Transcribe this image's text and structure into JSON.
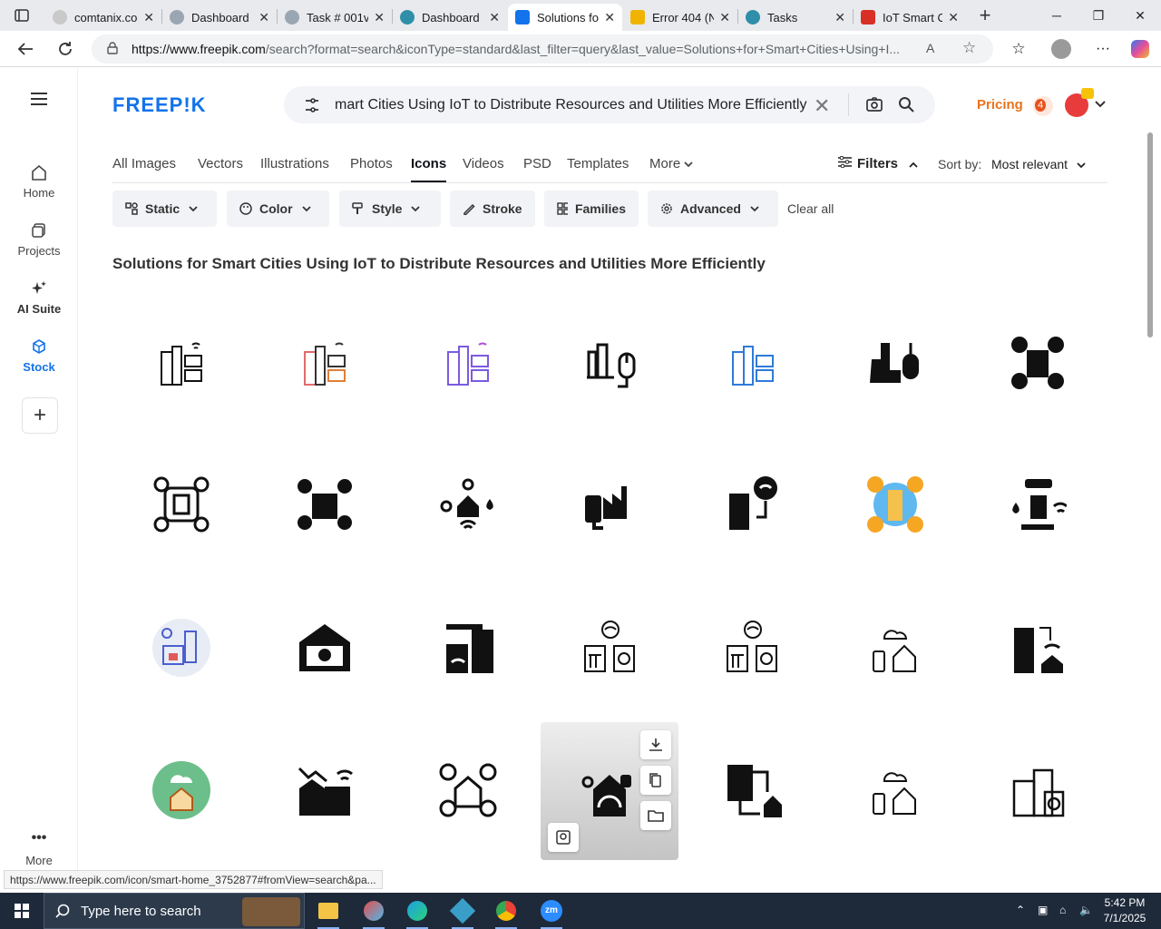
{
  "browser": {
    "tabs": [
      {
        "title": "comtanix.co",
        "favicon_color": "#888888"
      },
      {
        "title": "Dashboard",
        "favicon_color": "#9aa6b2"
      },
      {
        "title": "Task # 001v-",
        "favicon_color": "#9aa6b2"
      },
      {
        "title": "Dashboard",
        "favicon_color": "#2f8fa8"
      },
      {
        "title": "Solutions fo",
        "favicon_color": "#1273eb"
      },
      {
        "title": "Error 404 (N",
        "favicon_color": "#f0b400"
      },
      {
        "title": "Tasks",
        "favicon_color": "#2f8fa8"
      },
      {
        "title": "IoT Smart C",
        "favicon_color": "#d93025"
      }
    ],
    "active_tab_index": 4,
    "url_host": "https://www.freepik.com",
    "url_rest": "/search?format=search&iconType=standard&last_filter=query&last_value=Solutions+for+Smart+Cities+Using+I..."
  },
  "sidebar": {
    "items": [
      {
        "label": "Home",
        "icon": "home-icon"
      },
      {
        "label": "Projects",
        "icon": "projects-icon"
      },
      {
        "label": "AI Suite",
        "icon": "sparkle-icon"
      },
      {
        "label": "Stock",
        "icon": "stock-icon"
      }
    ],
    "add_label": "+",
    "more_label": "More"
  },
  "header": {
    "logo": "FREEP!K",
    "search_query": "mart Cities Using IoT to Distribute Resources and Utilities More Efficiently",
    "pricing": "Pricing",
    "notification_count": "4"
  },
  "categories": [
    "All Images",
    "Vectors",
    "Illustrations",
    "Photos",
    "Icons",
    "Videos",
    "PSD",
    "Templates",
    "More"
  ],
  "active_category": "Icons",
  "filters_label": "Filters",
  "sort": {
    "label": "Sort by:",
    "value": "Most relevant"
  },
  "chips": [
    "Static",
    "Color",
    "Style",
    "Stroke",
    "Families",
    "Advanced"
  ],
  "clear_all": "Clear all",
  "heading": "Solutions for Smart Cities Using IoT to Distribute Resources and Utilities More Efficiently",
  "status_url": "https://www.freepik.com/icon/smart-home_3752877#fromView=search&pa...",
  "taskbar": {
    "search_placeholder": "Type here to search",
    "time": "5:42 PM",
    "date": "7/1/2025"
  },
  "colors": {
    "accent": "#1273eb",
    "pricing": "#e8741c",
    "taskbar": "#1e2a3a"
  }
}
